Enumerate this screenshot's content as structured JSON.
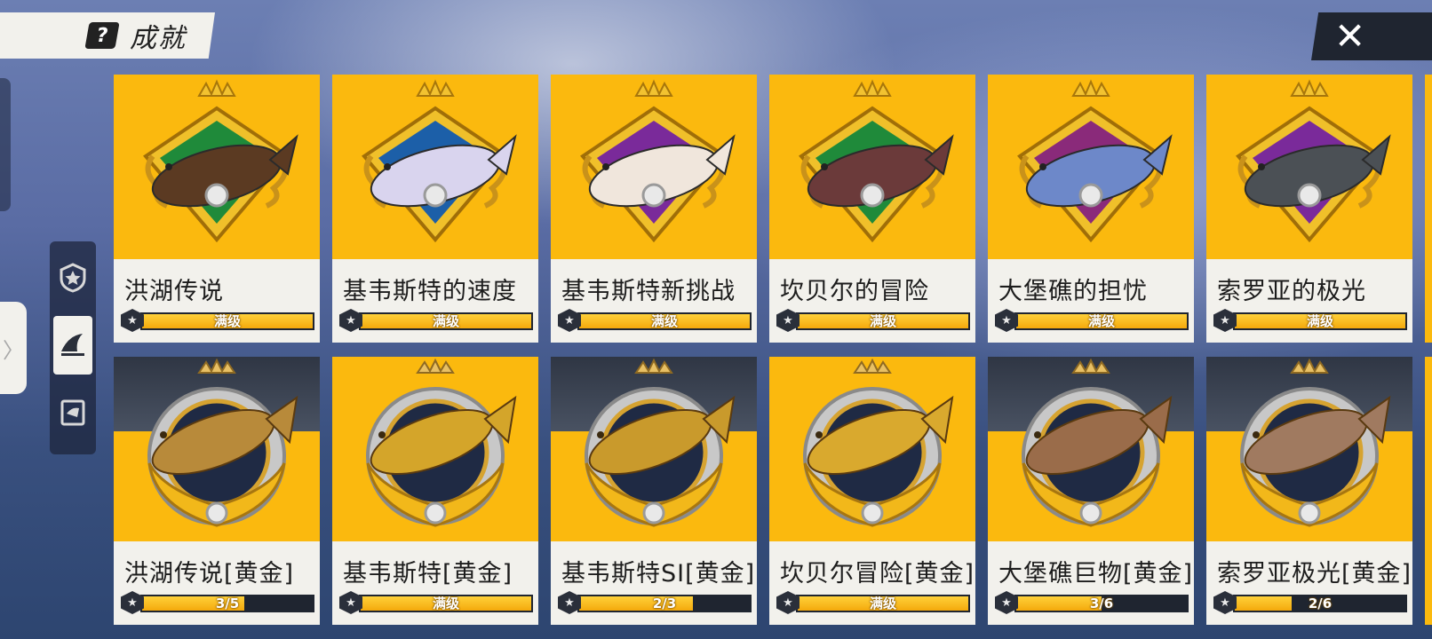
{
  "header": {
    "title": "成就",
    "title_icon": "?"
  },
  "close_icon": "✕",
  "drawer_tab_icon": "〉",
  "side_nav": [
    {
      "name": "badge-icon",
      "active": false
    },
    {
      "name": "fish-fin-icon",
      "active": true
    },
    {
      "name": "journal-icon",
      "active": false
    }
  ],
  "cards": [
    {
      "title": "洪湖传说",
      "progress_text": "满级",
      "progress": 1.0,
      "fish_color": "#5b3a22",
      "gem": "#1f8a3a",
      "style": "diamond"
    },
    {
      "title": "基韦斯特的速度",
      "progress_text": "满级",
      "progress": 1.0,
      "fish_color": "#d9d4ee",
      "gem": "#1c5fa8",
      "style": "diamond"
    },
    {
      "title": "基韦斯特新挑战",
      "progress_text": "满级",
      "progress": 1.0,
      "fish_color": "#f0e6dc",
      "gem": "#7a2a9a",
      "style": "diamond"
    },
    {
      "title": "坎贝尔的冒险",
      "progress_text": "满级",
      "progress": 1.0,
      "fish_color": "#6b3a3a",
      "gem": "#1f8a3a",
      "style": "diamond"
    },
    {
      "title": "大堡礁的担忧",
      "progress_text": "满级",
      "progress": 1.0,
      "fish_color": "#6d88c9",
      "gem": "#8a2a7a",
      "style": "diamond"
    },
    {
      "title": "索罗亚的极光",
      "progress_text": "满级",
      "progress": 1.0,
      "fish_color": "#4b5055",
      "gem": "#7a2a9a",
      "style": "diamond"
    },
    {
      "title": "洪湖传说[黄金]",
      "progress_text": "3/5",
      "progress": 0.6,
      "fish_color": "#b88a3a",
      "style": "round",
      "dark_top": true
    },
    {
      "title": "基韦斯特[黄金]",
      "progress_text": "满级",
      "progress": 1.0,
      "fish_color": "#d4a52a",
      "style": "round",
      "dark_top": false
    },
    {
      "title": "基韦斯特SI[黄金]",
      "progress_text": "2/3",
      "progress": 0.667,
      "fish_color": "#c99a2c",
      "style": "round",
      "dark_top": true
    },
    {
      "title": "坎贝尔冒险[黄金]",
      "progress_text": "满级",
      "progress": 1.0,
      "fish_color": "#d9a92e",
      "style": "round",
      "dark_top": false
    },
    {
      "title": "大堡礁巨物[黄金]",
      "progress_text": "3/6",
      "progress": 0.5,
      "fish_color": "#9a6c4a",
      "style": "round",
      "dark_top": true
    },
    {
      "title": "索罗亚极光[黄金]",
      "progress_text": "2/6",
      "progress": 0.333,
      "fish_color": "#a07a60",
      "style": "round",
      "dark_top": true
    }
  ]
}
